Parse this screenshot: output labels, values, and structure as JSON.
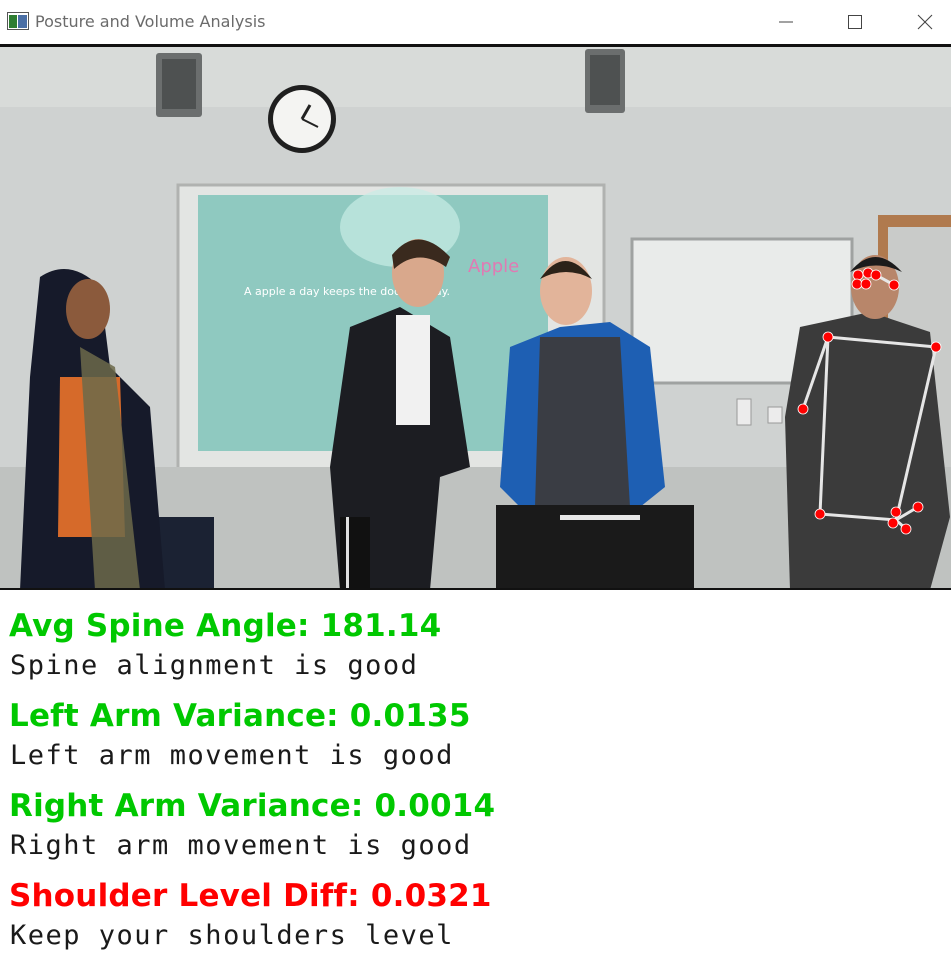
{
  "window": {
    "title": "Posture and Volume Analysis"
  },
  "video": {
    "slide_title": "Apple",
    "slide_caption": "A apple a day keeps the doctor away."
  },
  "metrics": [
    {
      "label": "Avg Spine Angle: 181.14",
      "color": "#00c800",
      "note": "Spine alignment is good"
    },
    {
      "label": "Left Arm Variance: 0.0135",
      "color": "#00c800",
      "note": "Left arm movement is good"
    },
    {
      "label": "Right Arm Variance: 0.0014",
      "color": "#00c800",
      "note": "Right arm movement is good"
    },
    {
      "label": "Shoulder Level Diff: 0.0321",
      "color": "#ff0000",
      "note": "Keep your shoulders level"
    }
  ],
  "icons": {
    "app": "window-app-icon",
    "minimize": "minimize-icon",
    "maximize": "maximize-icon",
    "close": "close-icon"
  }
}
